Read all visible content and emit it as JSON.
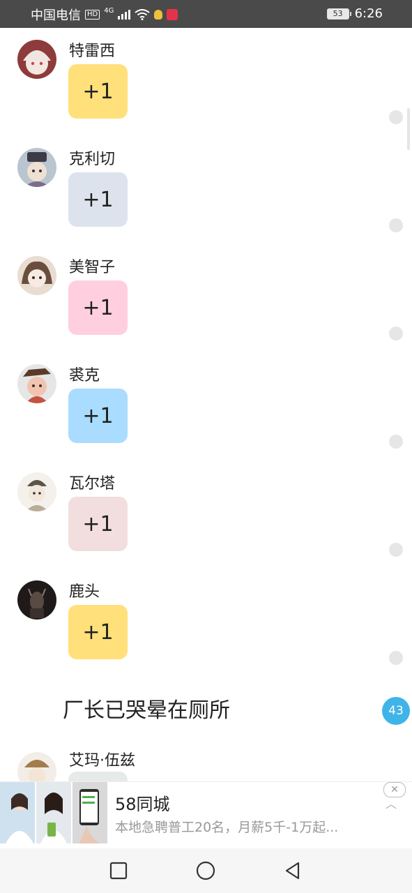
{
  "status_bar": {
    "carrier": "中国电信",
    "hd": "HD",
    "network": "4G",
    "battery": "53",
    "time": "6:26"
  },
  "entries": [
    {
      "name": "特雷西",
      "reaction": "+1",
      "card_color": "#ffe07a",
      "avatar_bg": "#9b3a3a"
    },
    {
      "name": "克利切",
      "reaction": "+1",
      "card_color": "#dde3ec",
      "avatar_bg": "#7b8a9a"
    },
    {
      "name": "美智子",
      "reaction": "+1",
      "card_color": "#ffcfdf",
      "avatar_bg": "#c7a58a"
    },
    {
      "name": "裘克",
      "reaction": "+1",
      "card_color": "#a9dcff",
      "avatar_bg": "#c86a4d"
    },
    {
      "name": "瓦尔塔",
      "reaction": "+1",
      "card_color": "#f2dede",
      "avatar_bg": "#b7ad9b"
    },
    {
      "name": "鹿头",
      "reaction": "+1",
      "card_color": "#ffe07a",
      "avatar_bg": "#2f2624"
    }
  ],
  "section_title": "厂长已哭晕在厕所",
  "count_badge": "43",
  "next_entry": {
    "name": "艾玛·伍兹"
  },
  "ad": {
    "title": "58同城",
    "description": "本地急聘普工20名，月薪5千-1万起...",
    "close_label": "✕",
    "chevron": "︿"
  },
  "nav": {
    "recents": "recents-square-icon",
    "home": "home-circle-icon",
    "back": "back-triangle-icon"
  }
}
